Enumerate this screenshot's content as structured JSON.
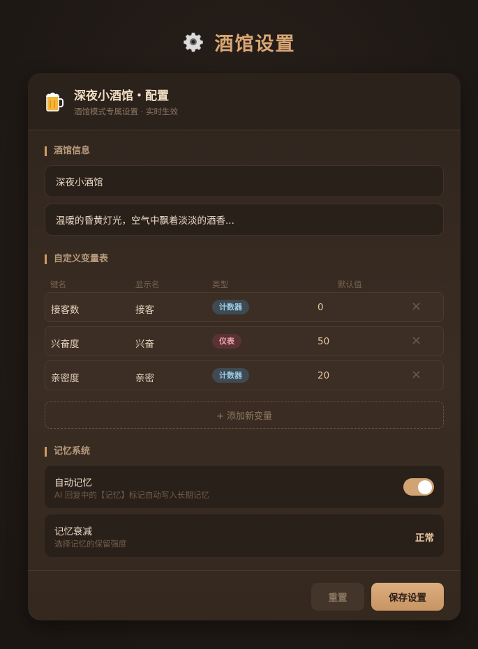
{
  "page": {
    "title": "酒馆设置",
    "icon": "gear-icon"
  },
  "card": {
    "title": "深夜小酒馆・配置",
    "subtitle": "酒馆模式专属设置 · 实时生效",
    "icon": "beer-mug-icon"
  },
  "tavern_info": {
    "label": "酒馆信息",
    "name_value": "深夜小酒馆",
    "desc_value": "温暖的昏黄灯光，空气中飘着淡淡的酒香..."
  },
  "variables": {
    "label": "自定义变量表",
    "columns": [
      "键名",
      "显示名",
      "类型",
      "默认值"
    ],
    "rows": [
      {
        "key": "接客数",
        "display": "接客",
        "type": "计数器",
        "default": "0",
        "remove": "×"
      },
      {
        "key": "兴奋度",
        "display": "兴奋",
        "type": "仪表",
        "default": "50",
        "remove": "×"
      },
      {
        "key": "亲密度",
        "display": "亲密",
        "type": "计数器",
        "default": "20",
        "remove": "×"
      }
    ],
    "add_label": "+ 添加新变量"
  },
  "memory": {
    "label": "记忆系统",
    "auto": {
      "title": "自动记忆",
      "desc": "AI 回复中的【记忆】标记自动写入长期记忆",
      "enabled": true
    },
    "decay": {
      "title": "记忆衰减",
      "desc": "选择记忆的保留强度",
      "value": "正常"
    }
  },
  "footer": {
    "reset_label": "重置",
    "save_label": "保存设置"
  },
  "colors": {
    "accent": "#d49a62",
    "background": "#1f1915",
    "card": "#3a2d23"
  }
}
